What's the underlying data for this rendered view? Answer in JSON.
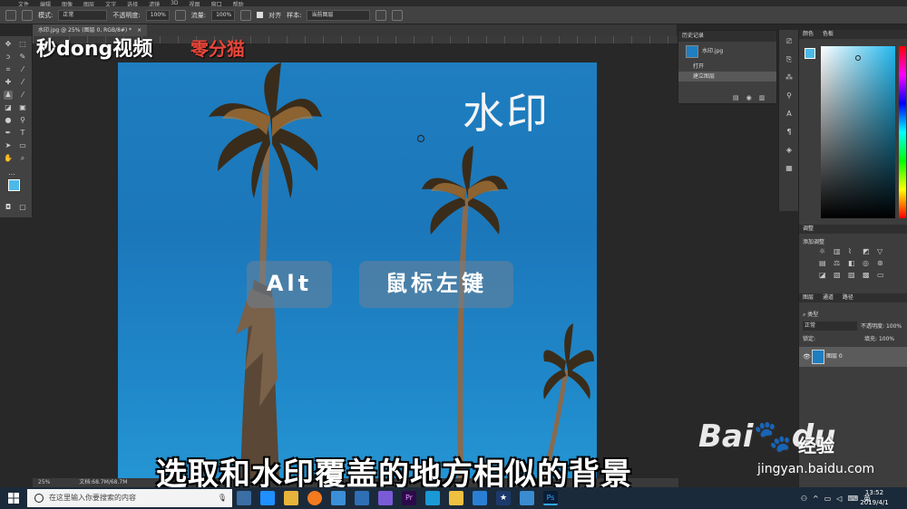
{
  "menu": {
    "items": [
      "文件",
      "编辑",
      "图像",
      "图层",
      "文字",
      "选择",
      "滤镜",
      "3D",
      "视图",
      "窗口",
      "帮助"
    ]
  },
  "options": {
    "mode_label": "模式:",
    "mode_value": "正常",
    "opacity_label": "不透明度:",
    "opacity_value": "100%",
    "flow_label": "流量:",
    "flow_value": "100%",
    "aligned_label": "对齐",
    "sample_label": "样本:",
    "sample_value": "当前图层"
  },
  "document": {
    "tab_title": "水印.jpg @ 25% (图层 0, RGB/8#) *",
    "zoom": "25%",
    "doc_size": "文档:68.7M/68.7M"
  },
  "watermark_text": "水印",
  "keys": {
    "alt": "Alt",
    "mouse": "鼠标左键"
  },
  "subtitle": "选取和水印覆盖的地方相似的背景",
  "logos": {
    "top_left": "秒dong视频",
    "cat": "零分猫",
    "baidu": "Bai",
    "baidu_du": "du",
    "baidu_jingyan": "经验",
    "baidu_url": "jingyan.baidu.com"
  },
  "history_panel": {
    "title": "历史记录",
    "snapshot": "水印.jpg",
    "items": [
      {
        "label": "打开"
      },
      {
        "label": "建立图层"
      }
    ]
  },
  "color_panel": {
    "tabs": [
      "颜色",
      "色板"
    ]
  },
  "adjust_panel": {
    "title": "调整",
    "subtitle": "添加调整"
  },
  "layers_panel": {
    "tabs": [
      "图层",
      "通道",
      "路径"
    ],
    "kind_label": "类型",
    "blend_mode": "正常",
    "opacity_label": "不透明度:",
    "opacity_value": "100%",
    "lock_label": "锁定:",
    "fill_label": "填充:",
    "fill_value": "100%",
    "layer_name": "图层 0"
  },
  "taskbar": {
    "search_placeholder": "在这里输入你要搜索的内容",
    "ime": "英",
    "time": "13:52",
    "date": "2019/4/1"
  },
  "colors": {
    "accent": "#1e7ec0",
    "taskbar": "#1b2a3a",
    "panel": "#3d3d3d"
  }
}
